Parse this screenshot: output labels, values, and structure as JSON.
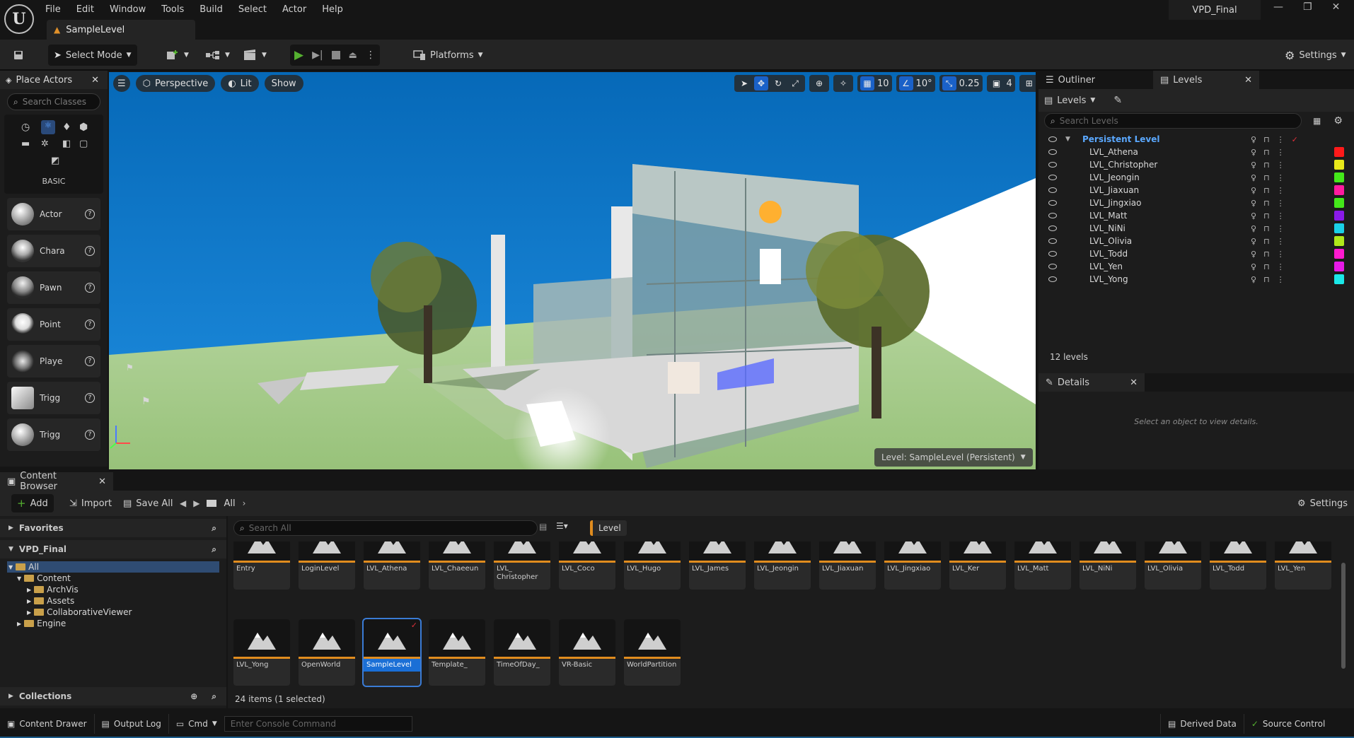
{
  "app": {
    "logo": "U",
    "menus": [
      "File",
      "Edit",
      "Window",
      "Tools",
      "Build",
      "Select",
      "Actor",
      "Help"
    ],
    "level_tab": "SampleLevel",
    "project_name": "VPD_Final",
    "window_controls": [
      "—",
      "❐",
      "✕"
    ]
  },
  "toolbar": {
    "mode_label": "Select Mode",
    "platforms_label": "Platforms",
    "settings_label": "Settings",
    "accent_play": "#55b030"
  },
  "place_actors": {
    "title": "Place Actors",
    "search_placeholder": "Search Classes",
    "category": "BASIC",
    "items": [
      {
        "label": "Actor"
      },
      {
        "label": "Chara"
      },
      {
        "label": "Pawn"
      },
      {
        "label": "Point"
      },
      {
        "label": "Playe"
      },
      {
        "label": "Trigg"
      },
      {
        "label": "Trigg"
      }
    ]
  },
  "viewport": {
    "perspective": "Perspective",
    "lit": "Lit",
    "show": "Show",
    "grid_snap": "10",
    "rot_snap": "10°",
    "scale_snap": "0.25",
    "camera_speed": "4",
    "level_label": "Level: SampleLevel (Persistent)"
  },
  "outliner": {
    "tab_outliner": "Outliner",
    "tab_levels": "Levels",
    "levels_dropdown": "Levels",
    "search_placeholder": "Search Levels",
    "persistent": "Persistent Level",
    "levels": [
      {
        "name": "LVL_Athena",
        "color": "#ff1a1a"
      },
      {
        "name": "LVL_Christopher",
        "color": "#e8e81a"
      },
      {
        "name": "LVL_Jeongin",
        "color": "#44e81a"
      },
      {
        "name": "LVL_Jiaxuan",
        "color": "#ff1aa0"
      },
      {
        "name": "LVL_Jingxiao",
        "color": "#44e81a"
      },
      {
        "name": "LVL_Matt",
        "color": "#8a1ae8"
      },
      {
        "name": "LVL_NiNi",
        "color": "#1ad0e8"
      },
      {
        "name": "LVL_Olivia",
        "color": "#b0e81a"
      },
      {
        "name": "LVL_Todd",
        "color": "#ff1ad0"
      },
      {
        "name": "LVL_Yen",
        "color": "#e81ae8"
      },
      {
        "name": "LVL_Yong",
        "color": "#1ae8e8"
      }
    ],
    "count_label": "12 levels"
  },
  "details": {
    "title": "Details",
    "empty_text": "Select an object to view details."
  },
  "content_browser": {
    "title": "Content Browser",
    "add": "Add",
    "import": "Import",
    "save_all": "Save All",
    "path": "All",
    "settings": "Settings",
    "favorites": "Favorites",
    "project": "VPD_Final",
    "tree": {
      "all": "All",
      "content": "Content",
      "children": [
        "ArchVis",
        "Assets",
        "CollaborativeViewer"
      ],
      "engine": "Engine"
    },
    "collections": "Collections",
    "search_placeholder": "Search All",
    "filter_chip": "Level",
    "assets_row1": [
      "Entry",
      "LoginLevel",
      "LVL_Athena",
      "LVL_Chaeeun",
      "LVL_ Christopher",
      "LVL_Coco",
      "LVL_Hugo",
      "LVL_James",
      "LVL_Jeongin",
      "LVL_Jiaxuan",
      "LVL_Jingxiao",
      "LVL_Ker",
      "LVL_Matt",
      "LVL_NiNi",
      "LVL_Olivia",
      "LVL_Todd",
      "LVL_Yen"
    ],
    "assets_row2": [
      "LVL_Yong",
      "OpenWorld",
      "SampleLevel",
      "Template_",
      "TimeOfDay_",
      "VR-Basic",
      "WorldPartition"
    ],
    "selected_asset": "SampleLevel",
    "items_count": "24 items (1 selected)"
  },
  "statusbar": {
    "content_drawer": "Content Drawer",
    "output_log": "Output Log",
    "cmd": "Cmd",
    "console_placeholder": "Enter Console Command",
    "derived_data": "Derived Data",
    "source_control": "Source Control"
  }
}
